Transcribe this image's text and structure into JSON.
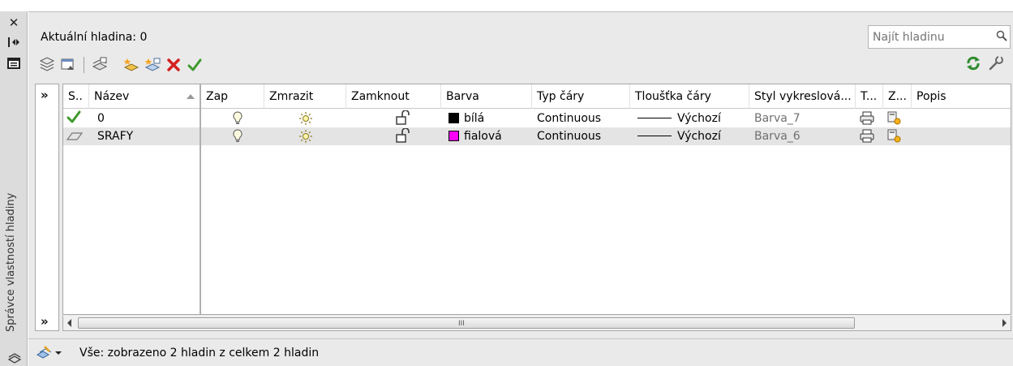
{
  "palette": {
    "title": "Správce vlastností hladiny",
    "close_icon": "close-icon",
    "autohide_icon": "autohide-icon",
    "properties_icon": "properties-icon"
  },
  "header": {
    "current_layer": "Aktuální hladina: 0",
    "search_placeholder": "Najít hladinu"
  },
  "toolbar": {
    "left_icons": [
      "new-property-filter-icon",
      "new-group-filter-icon",
      "layer-states-manager-icon",
      "new-layer-icon",
      "new-layer-vp-frozen-icon",
      "delete-layer-icon",
      "set-current-icon"
    ],
    "right_icons": [
      "refresh-icon",
      "settings-icon"
    ]
  },
  "tree": {
    "expand_top": "»",
    "expand_bottom": "»"
  },
  "table": {
    "columns": [
      "S..",
      "Název",
      "Zap",
      "Zmrazit",
      "Zamknout",
      "Barva",
      "Typ čáry",
      "Tloušťka čáry",
      "Styl vykreslová...",
      "T...",
      "Z...",
      "Popis"
    ],
    "rows": [
      {
        "status": "current-check-icon",
        "name": "0",
        "on": "lightbulb-on-icon",
        "freeze": "sun-thawed-icon",
        "lock": "unlocked-icon",
        "color_hex": "#000000",
        "color_name": "bílá",
        "linetype": "Continuous",
        "lineweight": "Výchozí",
        "plot_style": "Barva_7",
        "plot": "printer-icon",
        "new_vp_freeze": "vp-freeze-icon",
        "description": ""
      },
      {
        "status": "layer-icon",
        "name": "SRAFY",
        "on": "lightbulb-on-icon",
        "freeze": "sun-thawed-icon",
        "lock": "unlocked-icon",
        "color_hex": "#ff00ff",
        "color_name": "fialová",
        "linetype": "Continuous",
        "lineweight": "Výchozí",
        "plot_style": "Barva_6",
        "plot": "printer-icon",
        "new_vp_freeze": "vp-freeze-icon",
        "description": ""
      }
    ]
  },
  "scrollbar": {
    "grip": "III"
  },
  "status_bar": {
    "text": "Vše: zobrazeno 2 hladin z celkem 2 hladin"
  }
}
